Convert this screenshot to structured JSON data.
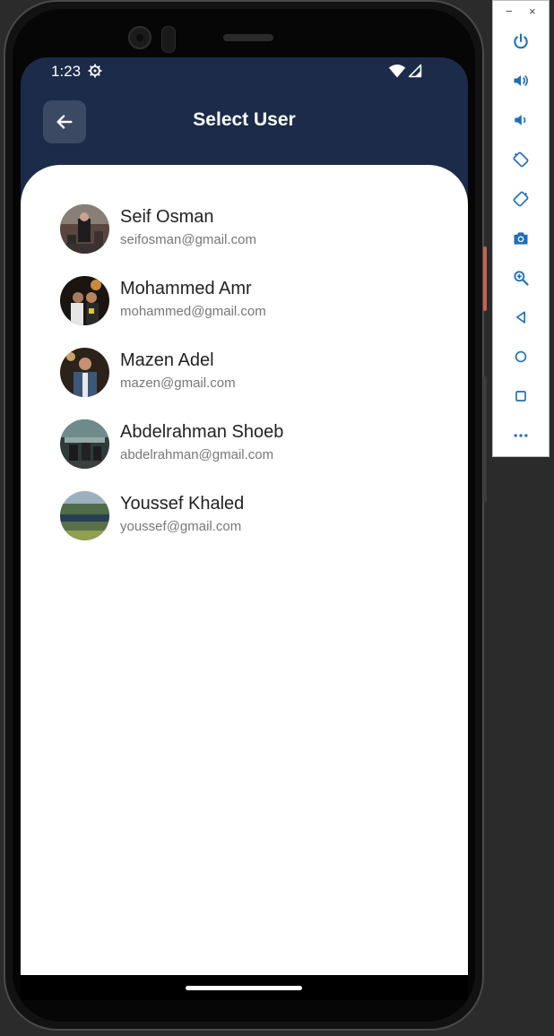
{
  "status_bar": {
    "time": "1:23",
    "icons": [
      "gear-icon",
      "wifi-icon",
      "signal-icon"
    ]
  },
  "header": {
    "title": "Select User",
    "back_icon": "arrow-left-icon"
  },
  "users": [
    {
      "name": "Seif Osman",
      "email": "seifosman@gmail.com"
    },
    {
      "name": "Mohammed Amr",
      "email": "mohammed@gmail.com"
    },
    {
      "name": "Mazen Adel",
      "email": "mazen@gmail.com"
    },
    {
      "name": "Abdelrahman Shoeb",
      "email": "abdelrahman@gmail.com"
    },
    {
      "name": "Youssef Khaled",
      "email": "youssef@gmail.com"
    }
  ],
  "emulator_toolbar": {
    "window_controls": [
      "−",
      "×"
    ],
    "buttons": [
      "power-icon",
      "volume-up-icon",
      "volume-down-icon",
      "rotate-left-icon",
      "rotate-right-icon",
      "camera-icon",
      "zoom-icon",
      "back-triangle-icon",
      "home-circle-icon",
      "overview-square-icon",
      "more-icon"
    ]
  },
  "colors": {
    "header_bg": "#1b2b49",
    "back_button_bg": "#3b4963",
    "content_bg": "#ffffff",
    "name_text": "#222222",
    "email_text": "#777777",
    "emulator_icon": "#1e6fb8"
  }
}
